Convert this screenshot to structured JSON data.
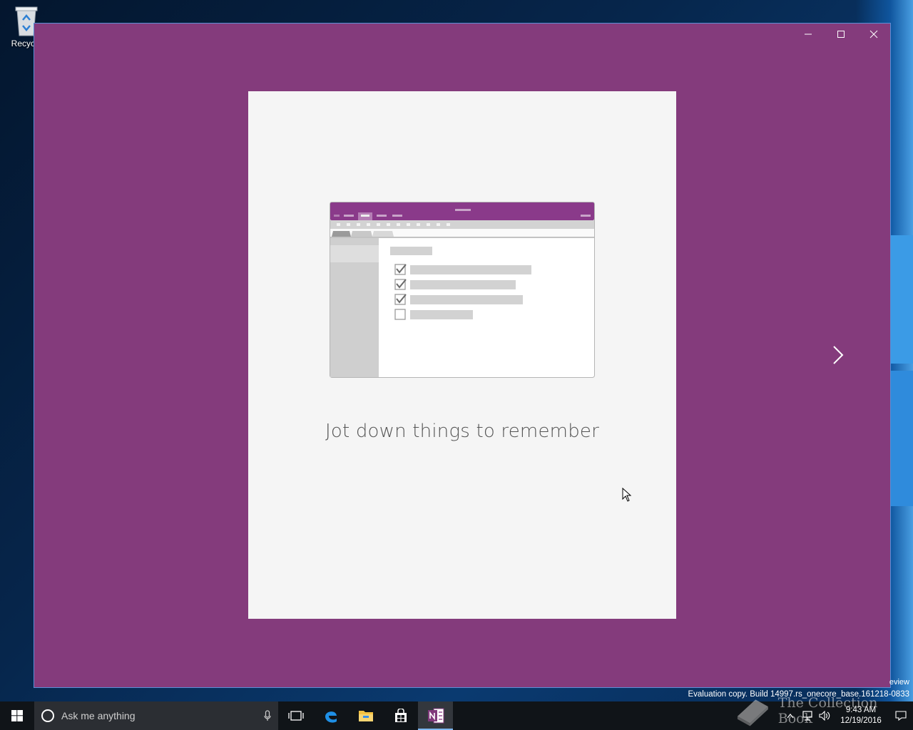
{
  "desktop": {
    "recycle_bin_label": "Recycle"
  },
  "window": {
    "background": "#843b7c",
    "card_caption": "Jot down things to remember",
    "illustration": {
      "checklist": [
        {
          "checked": true
        },
        {
          "checked": true
        },
        {
          "checked": true
        },
        {
          "checked": false
        }
      ]
    }
  },
  "watermark": {
    "edge_text": "eview",
    "evaluation": "Evaluation copy. Build 14997.rs_onecore_base.161218-0833",
    "collection": "The Collection Book"
  },
  "taskbar": {
    "search_placeholder": "Ask me anything",
    "clock_time": "9:43 AM",
    "clock_date": "12/19/2016",
    "apps": [
      "Task View",
      "Microsoft Edge",
      "File Explorer",
      "Store",
      "OneNote"
    ]
  }
}
